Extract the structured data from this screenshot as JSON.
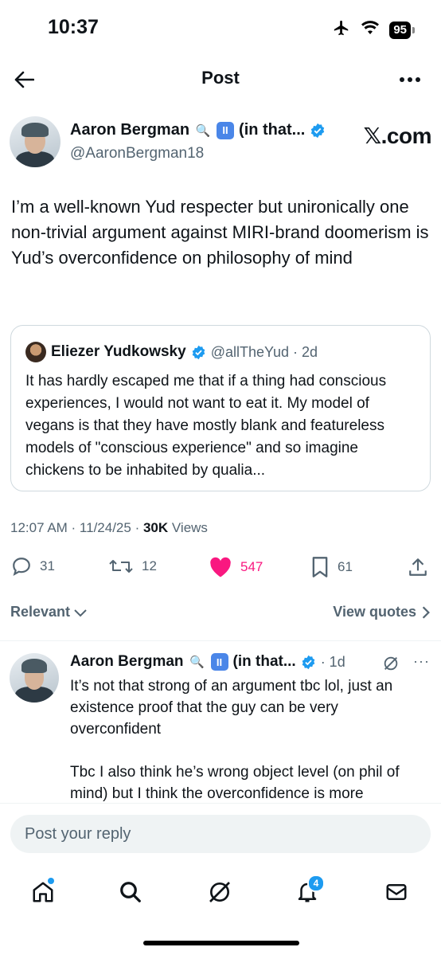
{
  "status_bar": {
    "time": "10:37",
    "battery": "95"
  },
  "header": {
    "title": "Post"
  },
  "post": {
    "author_name": "Aaron Bergman",
    "name_suffix": "(in that...",
    "handle": "@AaronBergman18",
    "brand": "𝕏.com",
    "text": "I’m a well-known Yud respecter but unironically one non-trivial argument against MIRI-brand doomerism is Yud’s overconfidence on philosophy of mind",
    "quote": {
      "author_name": "Eliezer Yudkowsky",
      "handle_time": "@allTheYud · 2d",
      "text": "It has hardly escaped me that if a thing had conscious experiences, I would not want to eat it. My model of vegans is that they have mostly blank and featureless models of \"conscious experience\" and so imagine chickens to be inhabited by qualia..."
    },
    "timestamp": "12:07 AM · 11/24/25 · ",
    "views_count": "30K",
    "views_label": " Views",
    "actions": {
      "replies": "31",
      "reposts": "12",
      "likes": "547",
      "bookmarks": "61"
    }
  },
  "sort": {
    "relevant_label": "Relevant",
    "view_quotes_label": "View quotes"
  },
  "reply": {
    "author_name": "Aaron Bergman",
    "name_suffix": "(in that...",
    "time": "· 1d",
    "text": "It’s not that strong of an argument tbc lol, just an existence proof that the guy can be very overconfident\n\nTbc I also think he’s wrong object level (on phil of mind) but I think the overconfidence is more"
  },
  "reply_box": {
    "placeholder": "Post your reply"
  },
  "tab_bar": {
    "notifications_badge": "4"
  },
  "colors": {
    "accent": "#1d9bf0",
    "like": "#f91880",
    "secondary_text": "#536471"
  },
  "icons": [
    "back-arrow-icon",
    "more-icon",
    "search-emoji-icon",
    "pause-emoji-icon",
    "verified-icon",
    "reply-icon",
    "repost-icon",
    "heart-icon",
    "bookmark-icon",
    "share-icon",
    "chevron-down-icon",
    "chevron-right-icon",
    "grok-icon",
    "home-icon",
    "search-icon",
    "grok-tab-icon",
    "bell-icon",
    "mail-icon"
  ]
}
